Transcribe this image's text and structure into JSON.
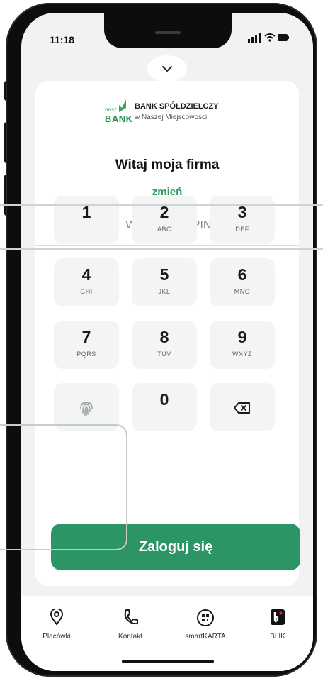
{
  "status_bar": {
    "time": "11:18"
  },
  "bank": {
    "logo_small": "nasz",
    "logo_bank": "BANK",
    "name": "BANK SPÓŁDZIELCZY",
    "subname": "w Naszej Miejscowości"
  },
  "greeting": "Witaj moja firma",
  "change_link": "zmień",
  "pin": {
    "placeholder": "Wprowadź e-PIN",
    "value": ""
  },
  "keypad": {
    "keys": [
      {
        "digit": "1",
        "letters": ""
      },
      {
        "digit": "2",
        "letters": "ABC"
      },
      {
        "digit": "3",
        "letters": "DEF"
      },
      {
        "digit": "4",
        "letters": "GHI"
      },
      {
        "digit": "5",
        "letters": "JKL"
      },
      {
        "digit": "6",
        "letters": "MNO"
      },
      {
        "digit": "7",
        "letters": "PQRS"
      },
      {
        "digit": "8",
        "letters": "TUV"
      },
      {
        "digit": "9",
        "letters": "WXYZ"
      },
      {
        "digit": "0",
        "letters": ""
      }
    ],
    "biometric_icon": "fingerprint-icon",
    "delete_icon": "backspace-icon"
  },
  "login_button": "Zaloguj się",
  "nav": {
    "items": [
      {
        "label": "Placówki",
        "icon": "location-pin-icon"
      },
      {
        "label": "Kontakt",
        "icon": "phone-icon"
      },
      {
        "label": "smartKARTA",
        "icon": "smart-card-icon"
      },
      {
        "label": "BLIK",
        "icon": "blik-icon"
      }
    ]
  },
  "colors": {
    "accent": "#2d9466",
    "link": "#2f9a5e",
    "key_bg": "#f3f5f4",
    "screen_bg": "#f1f3f2"
  }
}
